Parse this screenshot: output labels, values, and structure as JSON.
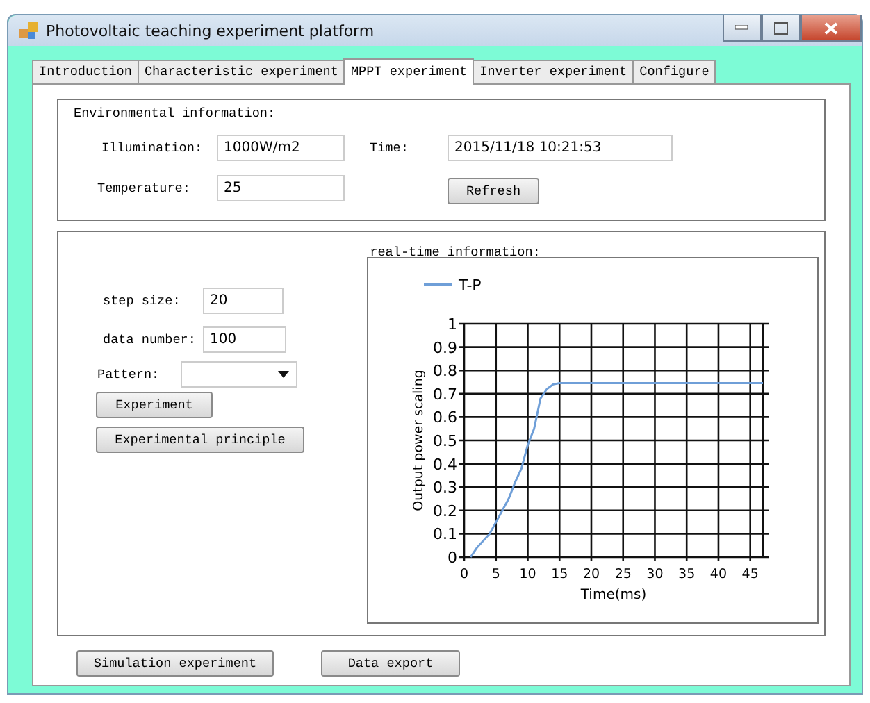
{
  "window": {
    "title": "Photovoltaic teaching experiment platform"
  },
  "tabs": [
    {
      "label": "Introduction",
      "selected": false
    },
    {
      "label": "Characteristic experiment",
      "selected": false
    },
    {
      "label": "MPPT experiment",
      "selected": true
    },
    {
      "label": "Inverter experiment",
      "selected": false
    },
    {
      "label": "Configure",
      "selected": false
    }
  ],
  "environment": {
    "title": "Environmental information:",
    "illumination_label": "Illumination:",
    "illumination": "1000W/m2",
    "time_label": "Time:",
    "time": "2015/11/18 10:21:53",
    "temperature_label": "Temperature:",
    "temperature": "25",
    "refresh_button": "Refresh"
  },
  "realtime": {
    "title": "real-time information:",
    "step_size_label": "step size:",
    "step_size": "20",
    "data_number_label": "data number:",
    "data_number": "100",
    "pattern_label": "Pattern:",
    "experiment_button": "Experiment",
    "principle_button": "Experimental principle",
    "chart_data": {
      "type": "line",
      "xlabel": "Time(ms)",
      "ylabel": "Output power scaling",
      "x": [
        1,
        2,
        4,
        5,
        7,
        8,
        9,
        10,
        11,
        12,
        13,
        14,
        15,
        47
      ],
      "series": [
        {
          "name": "T-P",
          "color": "#6f9fd8",
          "values": [
            0,
            0.04,
            0.1,
            0.15,
            0.25,
            0.32,
            0.38,
            0.48,
            0.55,
            0.68,
            0.72,
            0.74,
            0.745,
            0.745
          ]
        }
      ],
      "grid": true,
      "xlim": [
        0,
        47
      ],
      "ylim": [
        0,
        1
      ],
      "xticks": [
        0,
        5,
        10,
        15,
        20,
        25,
        30,
        35,
        40,
        45
      ],
      "yticks": [
        0,
        0.1,
        0.2,
        0.3,
        0.4,
        0.5,
        0.6,
        0.7,
        0.8,
        0.9,
        1
      ]
    }
  },
  "buttons": [
    "Simulation experiment",
    "Data export"
  ]
}
